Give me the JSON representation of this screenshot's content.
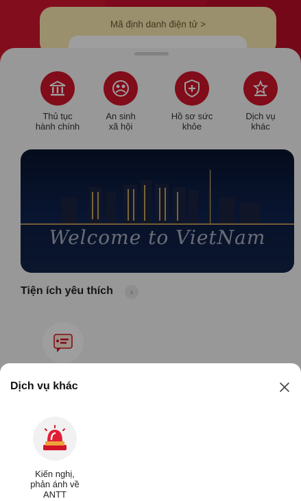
{
  "header": {
    "id_label": "Mã định danh điện tử  >"
  },
  "quick_actions": [
    {
      "label": "Thủ tục\nhành chính",
      "icon": "bank-icon"
    },
    {
      "label": "An sinh\nxã hội",
      "icon": "social-security-icon"
    },
    {
      "label": "Hồ sơ sức\nkhỏe",
      "icon": "health-shield-icon"
    },
    {
      "label": "Dịch vụ\nkhác",
      "icon": "other-services-icon"
    }
  ],
  "banner": {
    "text": "Welcome to VietNam"
  },
  "favorites": {
    "title": "Tiện ích yêu thích",
    "arrow": "›"
  },
  "sheet": {
    "title": "Dịch vụ khác",
    "close_icon": "close-icon",
    "items": [
      {
        "label": "Kiến nghị,\nphản ánh về\nANTT",
        "icon": "siren-icon"
      }
    ]
  },
  "colors": {
    "brand_red": "#c8102e",
    "id_card": "#fbe8b2"
  }
}
